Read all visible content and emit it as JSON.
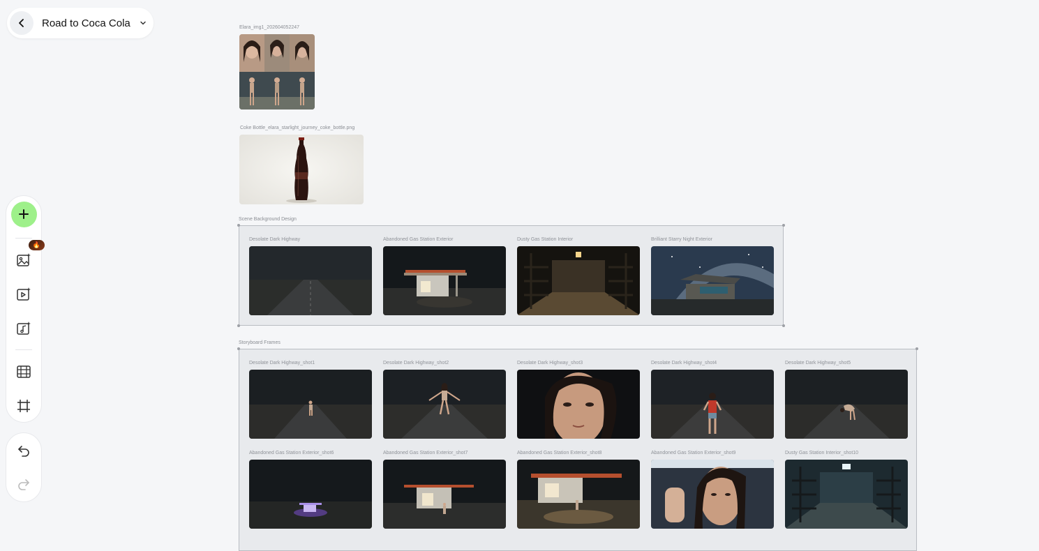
{
  "header": {
    "project_title": "Road to Coca Cola"
  },
  "icons": {
    "back": "chevron-left-icon",
    "dropdown": "chevron-down-icon",
    "add": "plus-icon",
    "image_gen": "image-sparkle-icon",
    "video_gen": "video-sparkle-icon",
    "audio_gen": "music-sparkle-icon",
    "storyboard": "film-grid-icon",
    "frame": "frame-icon",
    "undo": "undo-icon",
    "redo": "redo-icon"
  },
  "colors": {
    "accent_green": "#9ef08a",
    "canvas_bg": "#f5f6f8"
  },
  "canvas": {
    "character_sheet": {
      "caption": "Elara_img1_202604052247"
    },
    "product_image": {
      "caption": "Coke Bottle_elara_starlight_journey_coke_bottle.png"
    },
    "scene_group": {
      "title": "Scene Background Design",
      "items": [
        {
          "label": "Desolate Dark Highway"
        },
        {
          "label": "Abandoned Gas Station Exterior"
        },
        {
          "label": "Dusty Gas Station Interior"
        },
        {
          "label": "Brilliant Starry Night Exterior"
        }
      ]
    },
    "storyboard_group": {
      "title": "Storyboard Frames",
      "items": [
        {
          "label": "Desolate Dark Highway_shot1"
        },
        {
          "label": "Desolate Dark Highway_shot2"
        },
        {
          "label": "Desolate Dark Highway_shot3"
        },
        {
          "label": "Desolate Dark Highway_shot4"
        },
        {
          "label": "Desolate Dark Highway_shot5"
        },
        {
          "label": "Abandoned Gas Station Exterior_shot6"
        },
        {
          "label": "Abandoned Gas Station Exterior_shot7"
        },
        {
          "label": "Abandoned Gas Station Exterior_shot8"
        },
        {
          "label": "Abandoned Gas Station Exterior_shot9"
        },
        {
          "label": "Dusty Gas Station Interior_shot10"
        }
      ]
    }
  }
}
